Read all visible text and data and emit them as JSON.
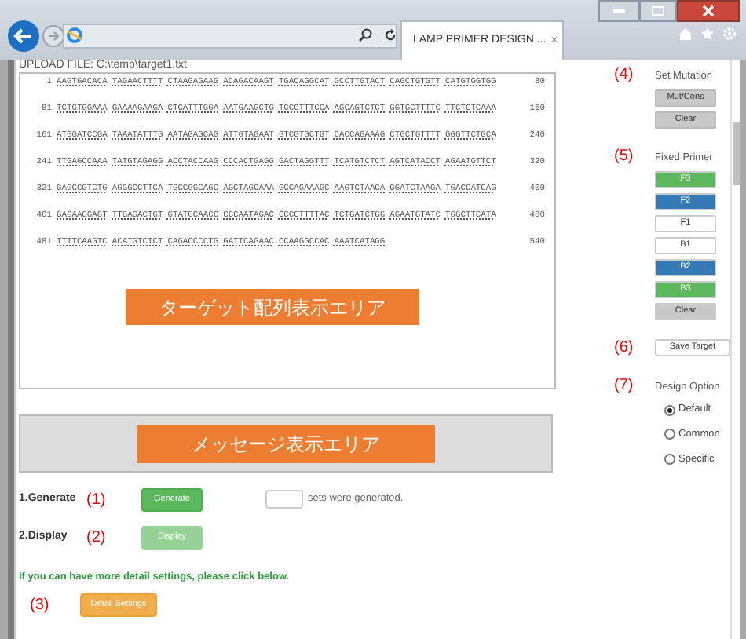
{
  "browser": {
    "tab_title": "LAMP PRIMER DESIGN ...",
    "tab_close": "×"
  },
  "upload_file": "UPLOAD FILE: C:\\temp\\target1.txt",
  "sequence_rows": [
    {
      "start": "1",
      "groups": [
        "AAGTGACACA",
        "TAGAACTTTT",
        "CTAAGAGAAG",
        "ACAGACAAGT",
        "TGACAGGCAT",
        "GCCTTGTACT",
        "CAGCTGTGTT",
        "CATGTGGTGG"
      ],
      "end": "80"
    },
    {
      "start": "81",
      "groups": [
        "TCTGTGGAAA",
        "GAAAAGAAGA",
        "CTCATTTGGA",
        "AATGAAGCTG",
        "TCCCTTTCCA",
        "AGCAGTCTCT",
        "GGTGCTTTTC",
        "TTCTCTCAAA"
      ],
      "end": "160"
    },
    {
      "start": "161",
      "groups": [
        "ATGGATCCGA",
        "TAAATATTTG",
        "AATAGAGCAG",
        "ATTGTAGAAT",
        "GTCGTGCTGT",
        "CACCAGAAAG",
        "CTGCTGTTTT",
        "GGGTTCTGCA"
      ],
      "end": "240"
    },
    {
      "start": "241",
      "groups": [
        "TTGAGCCAAA",
        "TATGTAGAGG",
        "ACCTACCAAG",
        "CCCACTGAGG",
        "GACTAGGTTT",
        "TCATGTCTCT",
        "AGTCATACCT",
        "AGAATGTTCT"
      ],
      "end": "320"
    },
    {
      "start": "321",
      "groups": [
        "GAGCCGTCTG",
        "AGGGCCTTCA",
        "TGCCGGCAGC",
        "AGCTAGCAAA",
        "GCCAGAAAGC",
        "AAGTCTAACA",
        "GGATCTAAGA",
        "TGACCATCAG"
      ],
      "end": "400"
    },
    {
      "start": "401",
      "groups": [
        "GAGAAGGAGT",
        "TTGAGACTGT",
        "GTATGCAACC",
        "CCCAATAGAC",
        "CCCCTTTTAC",
        "TCTGATCTGG",
        "AGAATGTATC",
        "TGGCTTCATA"
      ],
      "end": "480"
    },
    {
      "start": "481",
      "groups": [
        "TTTTCAAGTC",
        "ACATGTCTCT",
        "CAGACCCCTG",
        "GATTCAGAAC",
        "CCAAGGCCAC",
        "AAATCATAGG"
      ],
      "end": "540"
    }
  ],
  "target_area_label": "ターゲット配列表示エリア",
  "message_area_label": "メッセージ表示エリア",
  "generate": {
    "label": "1.Generate",
    "marker": "(1)",
    "button": "Generate",
    "count_suffix": "sets were generated."
  },
  "display": {
    "label": "2.Display",
    "marker": "(2)",
    "button": "Display",
    "disabled": true
  },
  "hint": "If you can have more detail settings, please click below.",
  "detail": {
    "marker": "(3)",
    "button": "Detail Settings"
  },
  "set_mutation": {
    "marker": "(4)",
    "title": "Set Mutation",
    "buttons": [
      "Mut/Cons",
      "Clear"
    ]
  },
  "fixed_primer": {
    "marker": "(5)",
    "title": "Fixed Primer",
    "buttons": [
      {
        "label": "F3",
        "color": "#5cb85c"
      },
      {
        "label": "F2",
        "color": "#337ab7"
      },
      {
        "label": "F1",
        "color": "#ffffff"
      },
      {
        "label": "B1",
        "color": "#ffffff"
      },
      {
        "label": "B2",
        "color": "#337ab7"
      },
      {
        "label": "B3",
        "color": "#5cb85c"
      },
      {
        "label": "Clear",
        "color": "#c8c8c8"
      }
    ]
  },
  "save_target": {
    "marker": "(6)",
    "button": "Save Target"
  },
  "design_option": {
    "marker": "(7)",
    "title": "Design Option",
    "options": [
      {
        "label": "Default",
        "selected": true
      },
      {
        "label": "Common",
        "selected": false
      },
      {
        "label": "Specific",
        "selected": false
      }
    ]
  }
}
